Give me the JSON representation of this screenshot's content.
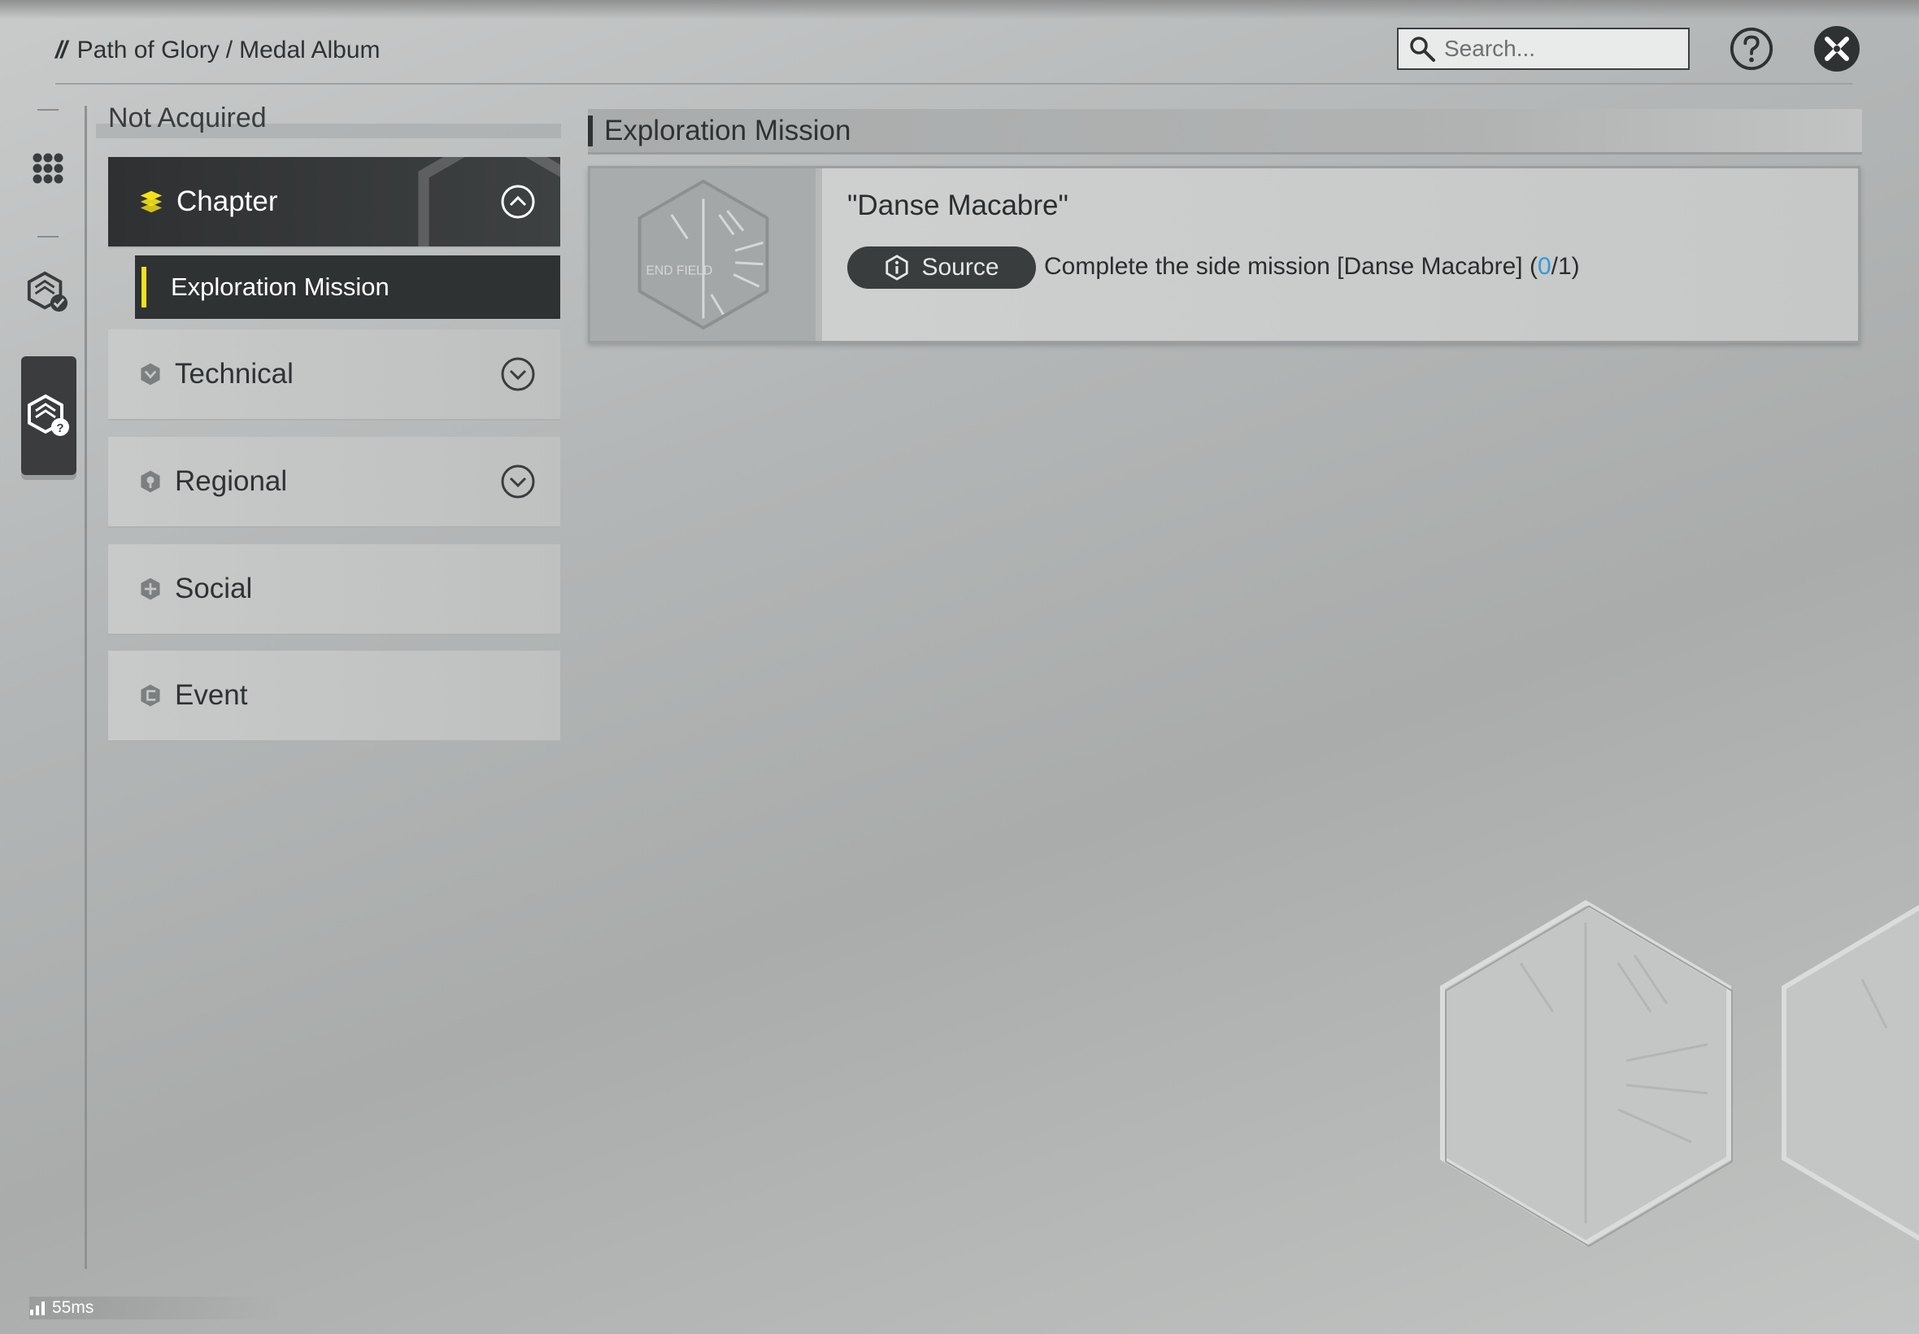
{
  "header": {
    "breadcrumb": [
      "Path of Glory",
      "Medal Album"
    ],
    "breadcrumb_sep": "/",
    "search_placeholder": "Search..."
  },
  "rail": {
    "icons": [
      "grid-icon",
      "medal-check-icon",
      "medal-question-icon"
    ],
    "active_index": 2
  },
  "panel": {
    "title": "Not Acquired",
    "categories": [
      {
        "label": "Chapter",
        "icon": "chapter-icon",
        "expanded": true,
        "has_toggle": true
      },
      {
        "label": "Technical",
        "icon": "technical-icon",
        "expanded": false,
        "has_toggle": true
      },
      {
        "label": "Regional",
        "icon": "regional-icon",
        "expanded": false,
        "has_toggle": true
      },
      {
        "label": "Social",
        "icon": "social-icon",
        "expanded": false,
        "has_toggle": false
      },
      {
        "label": "Event",
        "icon": "event-icon",
        "expanded": false,
        "has_toggle": false
      }
    ],
    "subcategory": {
      "label": "Exploration Mission",
      "selected": true
    }
  },
  "main": {
    "section_title": "Exploration Mission",
    "medal": {
      "name": "\"Danse Macabre\"",
      "source_label": "Source",
      "source_text_prefix": "Complete the side mission [Danse Macabre] (",
      "progress_current": "0",
      "progress_suffix": "/1)",
      "thumb_text": "END FIELD"
    }
  },
  "status": {
    "ping": "55ms"
  },
  "colors": {
    "accent_yellow": "#f5e215",
    "dark_panel": "#2f3233",
    "progress_blue": "#2f9ae0"
  }
}
